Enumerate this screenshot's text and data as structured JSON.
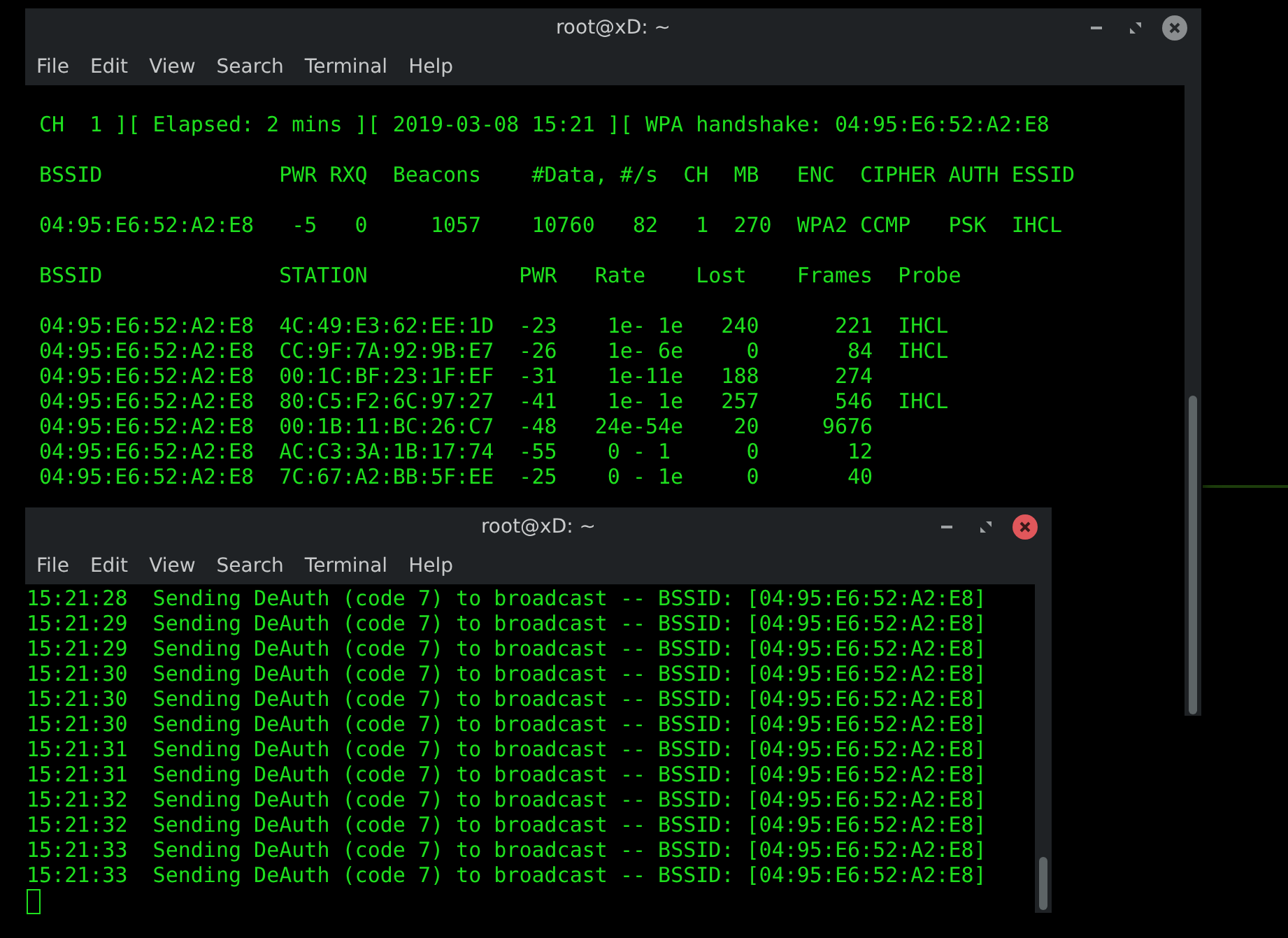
{
  "windows": [
    {
      "title": "root@xD: ~",
      "focused": false,
      "cursor": false,
      "menu": [
        "File",
        "Edit",
        "View",
        "Search",
        "Terminal",
        "Help"
      ],
      "sections": [
        [
          "CH  1 ][ Elapsed: 2 mins ][ 2019-03-08 15:21 ][ WPA handshake: 04:95:E6:52:A2:E8"
        ],
        [
          "BSSID              PWR RXQ  Beacons    #Data, #/s  CH  MB   ENC  CIPHER AUTH ESSID"
        ],
        [
          "04:95:E6:52:A2:E8   -5   0     1057    10760   82   1  270  WPA2 CCMP   PSK  IHCL"
        ],
        [
          "BSSID              STATION            PWR   Rate    Lost    Frames  Probe"
        ],
        [
          "04:95:E6:52:A2:E8  4C:49:E3:62:EE:1D  -23    1e- 1e   240      221  IHCL",
          "04:95:E6:52:A2:E8  CC:9F:7A:92:9B:E7  -26    1e- 6e     0       84  IHCL",
          "04:95:E6:52:A2:E8  00:1C:BF:23:1F:EF  -31    1e-11e   188      274",
          "04:95:E6:52:A2:E8  80:C5:F2:6C:97:27  -41    1e- 1e   257      546  IHCL",
          "04:95:E6:52:A2:E8  00:1B:11:BC:26:C7  -48   24e-54e    20     9676",
          "04:95:E6:52:A2:E8  AC:C3:3A:1B:17:74  -55    0 - 1      0       12",
          "04:95:E6:52:A2:E8  7C:67:A2:BB:5F:EE  -25    0 - 1e     0       40"
        ]
      ]
    },
    {
      "title": "root@xD: ~",
      "focused": true,
      "cursor": true,
      "menu": [
        "File",
        "Edit",
        "View",
        "Search",
        "Terminal",
        "Help"
      ],
      "sections": [
        [
          "15:21:28  Sending DeAuth (code 7) to broadcast -- BSSID: [04:95:E6:52:A2:E8]",
          "15:21:29  Sending DeAuth (code 7) to broadcast -- BSSID: [04:95:E6:52:A2:E8]",
          "15:21:29  Sending DeAuth (code 7) to broadcast -- BSSID: [04:95:E6:52:A2:E8]",
          "15:21:30  Sending DeAuth (code 7) to broadcast -- BSSID: [04:95:E6:52:A2:E8]",
          "15:21:30  Sending DeAuth (code 7) to broadcast -- BSSID: [04:95:E6:52:A2:E8]",
          "15:21:30  Sending DeAuth (code 7) to broadcast -- BSSID: [04:95:E6:52:A2:E8]",
          "15:21:31  Sending DeAuth (code 7) to broadcast -- BSSID: [04:95:E6:52:A2:E8]",
          "15:21:31  Sending DeAuth (code 7) to broadcast -- BSSID: [04:95:E6:52:A2:E8]",
          "15:21:32  Sending DeAuth (code 7) to broadcast -- BSSID: [04:95:E6:52:A2:E8]",
          "15:21:32  Sending DeAuth (code 7) to broadcast -- BSSID: [04:95:E6:52:A2:E8]",
          "15:21:33  Sending DeAuth (code 7) to broadcast -- BSSID: [04:95:E6:52:A2:E8]",
          "15:21:33  Sending DeAuth (code 7) to broadcast -- BSSID: [04:95:E6:52:A2:E8]"
        ]
      ]
    }
  ]
}
